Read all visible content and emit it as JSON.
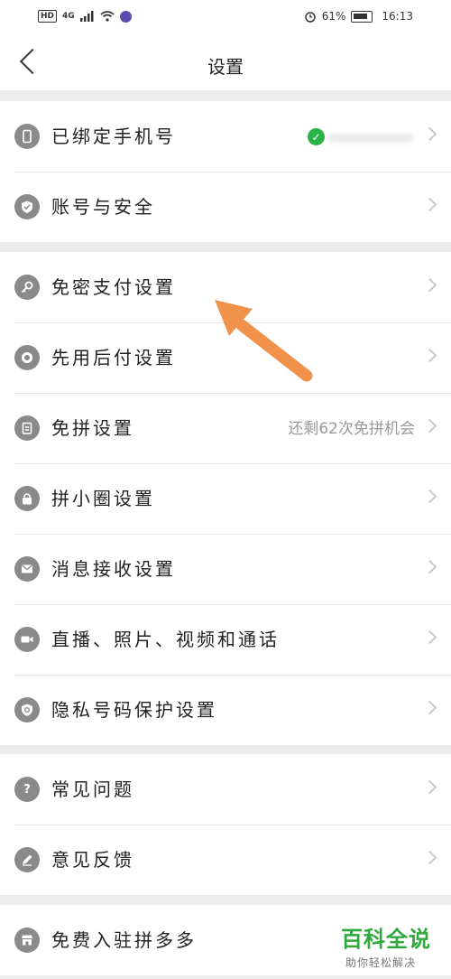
{
  "status_bar": {
    "hd": "HD",
    "network": "4G",
    "battery": "61%",
    "time": "16:13"
  },
  "header": {
    "title": "设置"
  },
  "groups": [
    [
      {
        "label": "已绑定手机号",
        "icon": "phone-icon"
      },
      {
        "label": "账号与安全",
        "icon": "shield-check-icon"
      }
    ],
    [
      {
        "label": "免密支付设置",
        "icon": "key-icon"
      },
      {
        "label": "先用后付设置",
        "icon": "badge-icon"
      },
      {
        "label": "免拼设置",
        "icon": "clipboard-icon",
        "value": "还剩62次免拼机会"
      },
      {
        "label": "拼小圈设置",
        "icon": "lock-icon"
      },
      {
        "label": "消息接收设置",
        "icon": "mail-icon"
      },
      {
        "label": "直播、照片、视频和通话",
        "icon": "video-icon"
      },
      {
        "label": "隐私号码保护设置",
        "icon": "phone-shield-icon"
      }
    ],
    [
      {
        "label": "常见问题",
        "icon": "question-icon"
      },
      {
        "label": "意见反馈",
        "icon": "pencil-icon"
      }
    ],
    [
      {
        "label": "免费入驻拼多多",
        "icon": "store-icon"
      }
    ]
  ],
  "annotation": {
    "color": "#f0924a"
  },
  "watermark": {
    "title": "百科全说",
    "subtitle": "助你轻松解决"
  },
  "colors": {
    "icon_gray": "#8a8a8a",
    "verified_green": "#2bb34a",
    "divider": "#ececec"
  }
}
